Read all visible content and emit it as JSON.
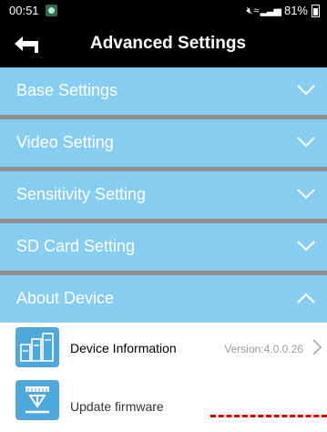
{
  "status_bar": {
    "time": "00:51",
    "signal_icons": "⊡ ≈░▌▐",
    "battery": "81%"
  },
  "header": {
    "title": "Advanced Settings"
  },
  "sections": [
    {
      "label": "Base Settings",
      "expanded": false
    },
    {
      "label": "Video Setting",
      "expanded": false
    },
    {
      "label": "Sensitivity Setting",
      "expanded": false
    },
    {
      "label": "SD Card Setting",
      "expanded": false
    },
    {
      "label": "About Device",
      "expanded": true
    }
  ],
  "about_device": {
    "device_information": {
      "label": "Device Information",
      "version": "Version:4.0.0.26"
    },
    "update_firmware": {
      "label": "Update firmware"
    }
  },
  "colors": {
    "section_bg": "#87cdf1",
    "divider": "#8f8f8f",
    "header_bg": "#000000",
    "annotation_dashes": "#e00000"
  },
  "icons": [
    "back-arrow-icon",
    "chevron-down-icon",
    "chevron-up-icon",
    "chevron-right-icon",
    "device-info-icon",
    "update-firmware-icon"
  ]
}
